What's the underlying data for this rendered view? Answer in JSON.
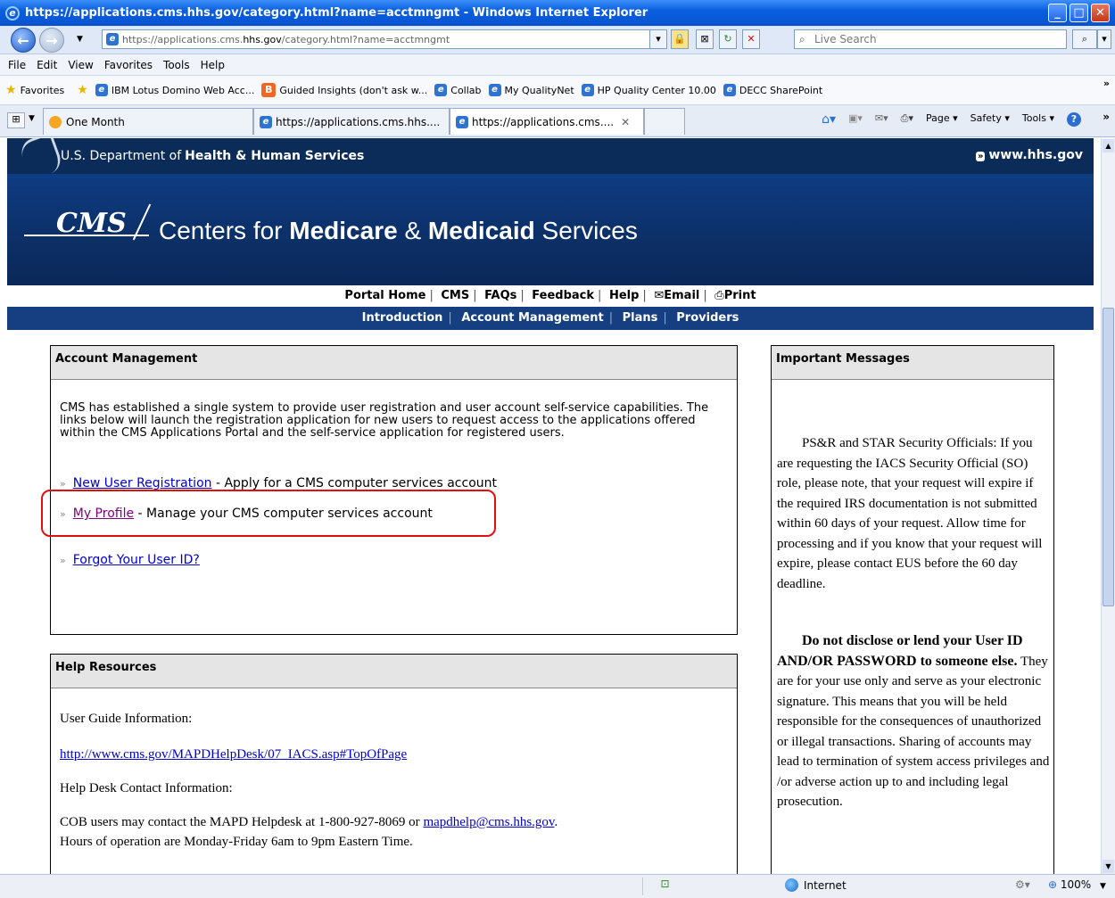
{
  "window": {
    "title": "https://applications.cms.hhs.gov/category.html?name=acctmngmt - Windows Internet Explorer"
  },
  "address": {
    "url_prefix": "https://applications.cms.",
    "url_domain": "hhs.gov",
    "url_rest": "/category.html?name=acctmngmt",
    "search_placeholder": "Live Search"
  },
  "menu": [
    "File",
    "Edit",
    "View",
    "Favorites",
    "Tools",
    "Help"
  ],
  "favorites": {
    "label": "Favorites",
    "items": [
      "IBM Lotus Domino Web Acc...",
      "Guided Insights (don't ask w...",
      "Collab",
      "My QualityNet",
      "HP Quality Center 10.00",
      "DECC SharePoint"
    ]
  },
  "tabs": [
    "One Month",
    "https://applications.cms.hhs....",
    "https://applications.cms...."
  ],
  "toolbar_right": [
    "Page ▾",
    "Safety ▾",
    "Tools ▾"
  ],
  "page": {
    "hhs_name_prefix": "U.S. Department of ",
    "hhs_name_bold": "Health & Human Services",
    "hhs_link": "www.hhs.gov",
    "cms_logo": "CMS",
    "cms_title_1": "Centers for ",
    "cms_title_2": "Medicare",
    "cms_title_3": " & ",
    "cms_title_4": "Medicaid",
    "cms_title_5": " Services",
    "topnav": [
      "Portal Home",
      "CMS",
      "FAQs",
      "Feedback",
      "Help",
      "Email",
      "Print"
    ],
    "subnav": [
      "Introduction",
      "Account Management",
      "Plans",
      "Providers"
    ],
    "account": {
      "heading": "Account Management",
      "intro": "CMS has established a single system to provide user registration and user account self-service capabilities. The links below will launch the registration application for new users to request access to the applications offered within the CMS Applications Portal and the self-service application for registered users.",
      "link1": "New User Registration",
      "link1_desc": " - Apply for a CMS computer services account",
      "link2": "My Profile",
      "link2_desc": " - Manage your CMS computer services account",
      "link3": "Forgot Your User ID?"
    },
    "help": {
      "heading": "Help Resources",
      "guide_label": "User Guide Information:",
      "guide_link": "http://www.cms.gov/MAPDHelpDesk/07_IACS.asp#TopOfPage",
      "desk_label": "Help Desk Contact Information:",
      "cob_text": "COB users may contact the MAPD Helpdesk at 1-800-927-8069 or ",
      "cob_email": "mapdhelp@cms.hhs.gov",
      "cob_end": ".",
      "hours": "Hours of operation are Monday-Friday 6am to 9pm Eastern Time."
    },
    "messages": {
      "heading": "Important Messages",
      "para1": "PS&R and STAR Security Officials: If you are requesting the IACS Security Official (SO) role, please note, that your request will expire if the required IRS documentation is not submitted within 60 days of your request.  Allow time for processing and if you know that your request will expire, please contact EUS before the 60 day deadline.",
      "para2_bold": "Do not disclose or lend your User ID AND/OR PASSWORD to someone else.",
      "para2_rest": " They are for your use only and serve as your electronic signature. This means that you will be held responsible for the consequences of unauthorized or illegal transactions. Sharing of accounts may lead to termination of system access privileges and /or adverse action up to and including legal prosecution."
    }
  },
  "status": {
    "zone": "Internet",
    "zoom": "100%"
  }
}
